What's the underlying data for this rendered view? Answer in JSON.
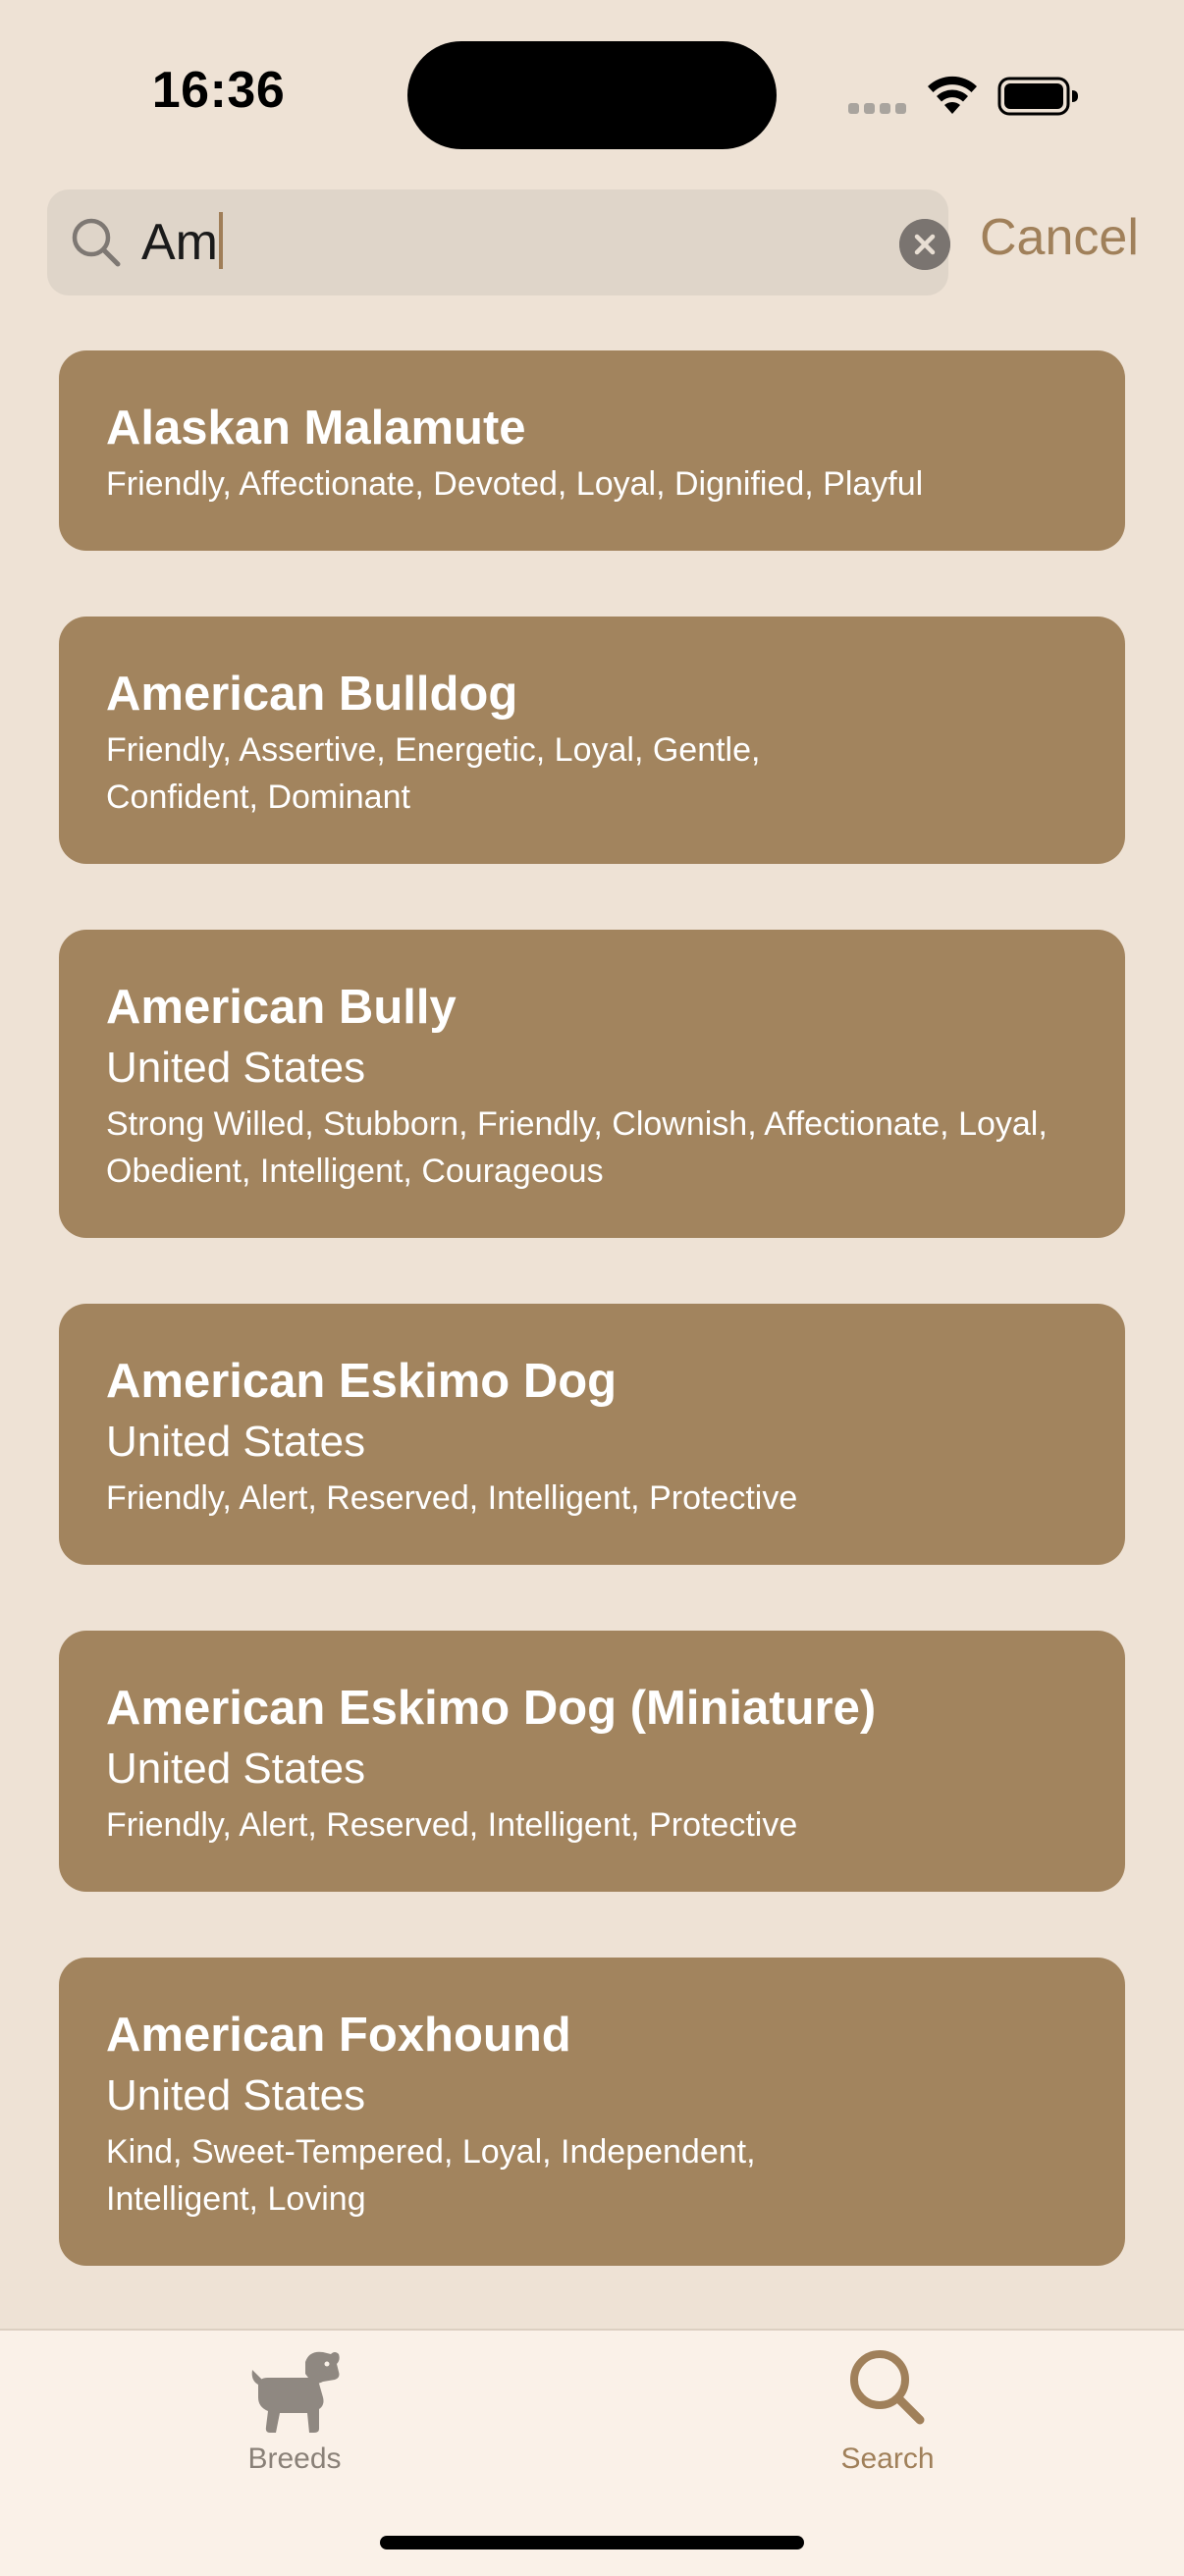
{
  "status_bar": {
    "time": "16:36"
  },
  "search": {
    "query": "Am",
    "cancel_label": "Cancel"
  },
  "results": [
    {
      "name": "Alaskan Malamute",
      "origin": "",
      "temperament": "Friendly, Affectionate, Devoted, Loyal, Dignified, Playful"
    },
    {
      "name": "American Bulldog",
      "origin": "",
      "temperament": "Friendly, Assertive, Energetic, Loyal, Gentle, Confident, Dominant"
    },
    {
      "name": "American Bully",
      "origin": "United States",
      "temperament": "Strong Willed, Stubborn, Friendly, Clownish, Affectionate, Loyal, Obedient, Intelligent, Courageous"
    },
    {
      "name": "American Eskimo Dog",
      "origin": "United States",
      "temperament": "Friendly, Alert, Reserved, Intelligent, Protective"
    },
    {
      "name": "American Eskimo Dog (Miniature)",
      "origin": "United States",
      "temperament": "Friendly, Alert, Reserved, Intelligent, Protective"
    },
    {
      "name": "American Foxhound",
      "origin": "United States",
      "temperament": "Kind, Sweet-Tempered, Loyal, Independent, Intelligent, Loving"
    }
  ],
  "tab_bar": {
    "tabs": [
      {
        "label": "Breeds",
        "icon": "dog-icon",
        "selected": false
      },
      {
        "label": "Search",
        "icon": "search-icon",
        "selected": true
      }
    ]
  },
  "colors": {
    "background": "#EEE2D5",
    "card": "#A2845E",
    "accent": "#A0805A",
    "search_field": "#DFD5C9",
    "tab_bar": "#FAF1E8"
  }
}
